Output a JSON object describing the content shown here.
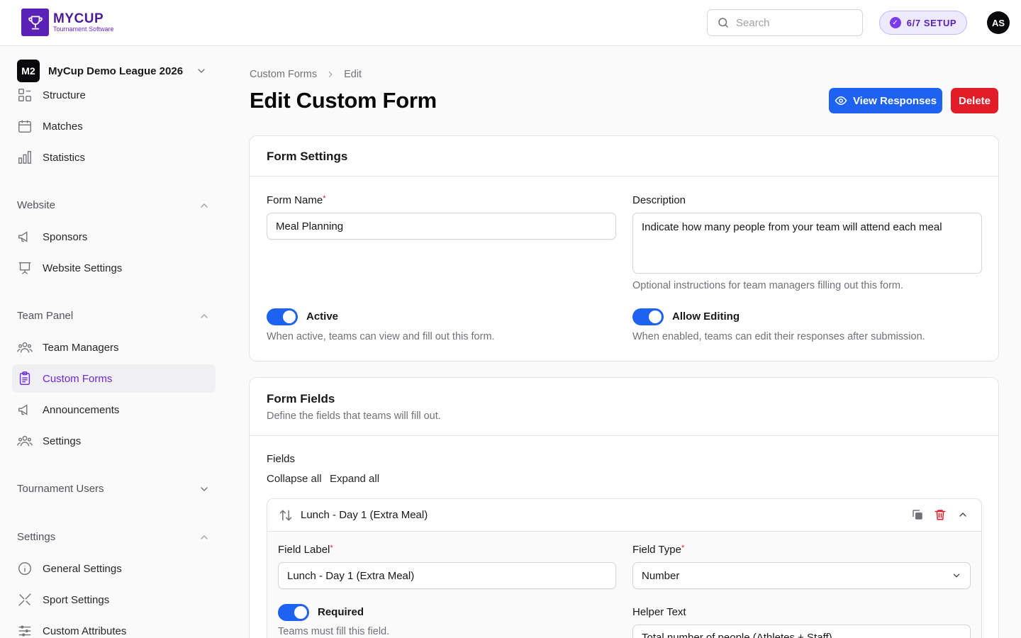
{
  "brand": {
    "name": "MYCUP",
    "tagline": "Tournament Software"
  },
  "search": {
    "placeholder": "Search"
  },
  "setup": {
    "label": "6/7 SETUP"
  },
  "user": {
    "initials": "AS"
  },
  "league": {
    "badge": "M2",
    "name": "MyCup Demo League 2026"
  },
  "sidebar": {
    "tournament_items": [
      {
        "label": "Structure",
        "icon": "structure-icon"
      },
      {
        "label": "Matches",
        "icon": "calendar-icon"
      },
      {
        "label": "Statistics",
        "icon": "bar-chart-icon"
      }
    ],
    "website": {
      "heading": "Website",
      "items": [
        {
          "label": "Sponsors",
          "icon": "megaphone-icon"
        },
        {
          "label": "Website Settings",
          "icon": "presentation-icon"
        }
      ]
    },
    "team_panel": {
      "heading": "Team Panel",
      "items": [
        {
          "label": "Team Managers",
          "icon": "users-icon"
        },
        {
          "label": "Custom Forms",
          "icon": "clipboard-icon",
          "active": true
        },
        {
          "label": "Announcements",
          "icon": "megaphone-icon"
        },
        {
          "label": "Settings",
          "icon": "users-cog-icon"
        }
      ]
    },
    "tournament_users": {
      "heading": "Tournament Users"
    },
    "settings": {
      "heading": "Settings",
      "items": [
        {
          "label": "General Settings",
          "icon": "info-icon"
        },
        {
          "label": "Sport Settings",
          "icon": "tools-icon"
        },
        {
          "label": "Custom Attributes",
          "icon": "sliders-icon"
        }
      ]
    }
  },
  "breadcrumb": {
    "parent": "Custom Forms",
    "current": "Edit"
  },
  "page": {
    "title": "Edit Custom Form",
    "view_responses": "View Responses",
    "delete": "Delete"
  },
  "form_settings": {
    "title": "Form Settings",
    "name_label": "Form Name",
    "name_value": "Meal Planning",
    "description_label": "Description",
    "description_value": "Indicate how many people from your team will attend each meal",
    "description_hint": "Optional instructions for team managers filling out this form.",
    "active_label": "Active",
    "active_hint": "When active, teams can view and fill out this form.",
    "active_on": true,
    "editing_label": "Allow Editing",
    "editing_hint": "When enabled, teams can edit their responses after submission.",
    "editing_on": true
  },
  "form_fields": {
    "title": "Form Fields",
    "subtitle": "Define the fields that teams will fill out.",
    "fields_label": "Fields",
    "collapse_all": "Collapse all",
    "expand_all": "Expand all",
    "items": [
      {
        "title": "Lunch - Day 1 (Extra Meal)",
        "label_label": "Field Label",
        "label_value": "Lunch - Day 1 (Extra Meal)",
        "type_label": "Field Type",
        "type_value": "Number",
        "required_label": "Required",
        "required_hint": "Teams must fill this field.",
        "required_on": true,
        "helper_label": "Helper Text",
        "helper_value": "Total number of people (Athletes + Staff)"
      }
    ]
  },
  "colors": {
    "accent": "#1d62f0",
    "brand": "#5b21b6",
    "danger": "#e11d2a",
    "active_nav": "#6d28d9"
  }
}
